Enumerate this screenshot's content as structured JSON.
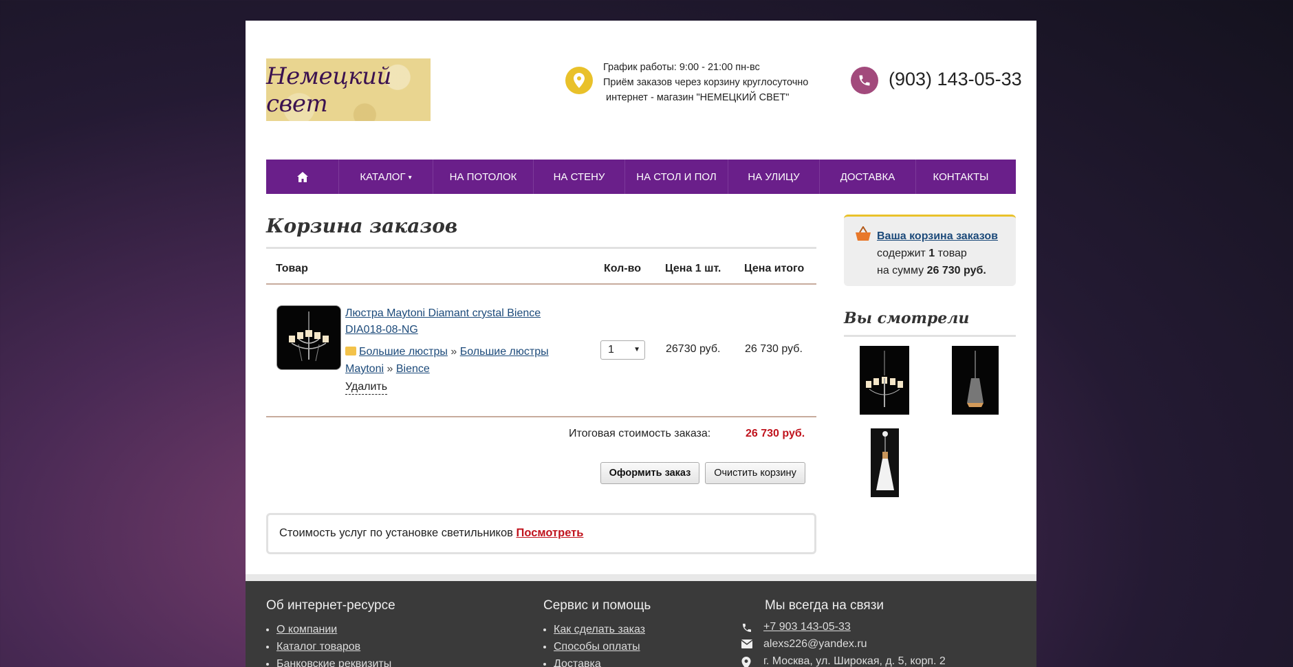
{
  "header": {
    "logo_text": "Немецкий свет",
    "schedule": "График работы: 9:00 - 21:00 пн-вс",
    "orders_line": "Приём заказов через корзину круглосуточно",
    "shop_line": "интернет - магазин \"НЕМЕЦКИЙ СВЕТ\"",
    "phone": "(903) 143-05-33"
  },
  "nav": {
    "home_icon": "home-icon",
    "items": [
      "КАТАЛОГ",
      "НА ПОТОЛОК",
      "НА СТЕНУ",
      "НА СТОЛ И ПОЛ",
      "НА УЛИЦУ",
      "ДОСТАВКА",
      "КОНТАКТЫ"
    ],
    "catalog_arrow": "▾"
  },
  "cart": {
    "title": "Корзина заказов",
    "columns": {
      "product": "Товар",
      "qty": "Кол-во",
      "unit_price": "Цена 1 шт.",
      "total": "Цена итого"
    },
    "item": {
      "name": "Люстра Maytoni Diamant crystal Bience DIA018-08-NG",
      "crumb1": "Большие люстры",
      "sep": "»",
      "crumb2": "Большие люстры Maytoni",
      "crumb3": "Bience",
      "delete": "Удалить",
      "qty": "1",
      "unit_price": "26730 руб.",
      "total": "26 730 руб."
    },
    "total_label": "Итоговая стоимость заказа:",
    "total_value": "26 730 руб.",
    "checkout_button": "Оформить заказ",
    "clear_button": "Очистить корзину",
    "install_text": "Стоимость услуг по установке светильников",
    "install_link": "Посмотреть"
  },
  "sidebar": {
    "cart_link": "Ваша корзина заказов",
    "contains": "содержит",
    "count": "1",
    "goods": "товар",
    "sum_prefix": "на сумму",
    "sum": "26 730 руб.",
    "seen_title": "Вы смотрели"
  },
  "footer": {
    "col1_title": "Об интернет-ресурсе",
    "col1_links": [
      "О компании",
      "Каталог товаров",
      "Банковские реквизиты"
    ],
    "col2_title": "Сервис и помощь",
    "col2_links": [
      "Как сделать заказ",
      "Способы оплаты",
      "Доставка"
    ],
    "col3_title": "Мы всегда на связи",
    "phone": "+7 903 143-05-33",
    "email": "alexs226@yandex.ru",
    "address": "г. Москва, ул. Широкая, д. 5, корп. 2"
  },
  "colors": {
    "nav": "#6a1f8a",
    "accent_red": "#c0131d",
    "link": "#1c4a7a",
    "pin": "#e9c12a",
    "phone_bg": "#a24a7c"
  }
}
